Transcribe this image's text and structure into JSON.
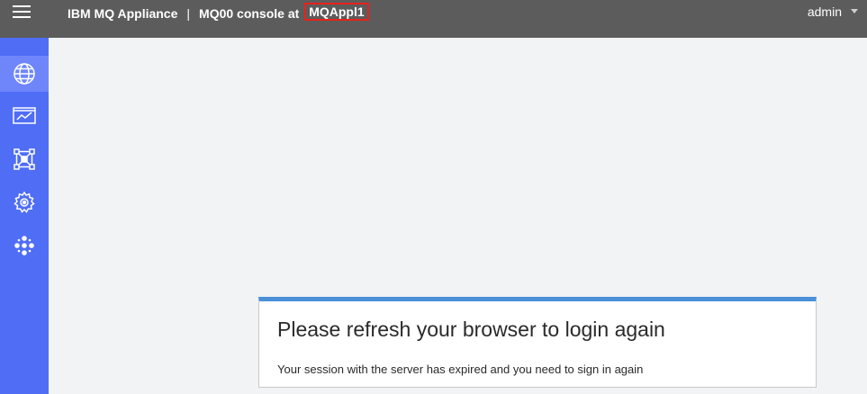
{
  "header": {
    "product": "IBM MQ Appliance",
    "separator": "|",
    "console_label": "MQ00 console at",
    "appliance_name": "MQAppl1",
    "user": "admin"
  },
  "sidebar": {
    "items": [
      {
        "icon": "globe-icon",
        "active": true
      },
      {
        "icon": "monitor-chart-icon",
        "active": false
      },
      {
        "icon": "network-nodes-icon",
        "active": false
      },
      {
        "icon": "gear-icon",
        "active": false
      },
      {
        "icon": "dots-cluster-icon",
        "active": false
      }
    ]
  },
  "dialog": {
    "title": "Please refresh your browser to login again",
    "message": "Your session with the server has expired and you need to sign in again"
  },
  "colors": {
    "topbar": "#5c5c5c",
    "sidebar": "#4f6df5",
    "sidebar_active": "#6f86fb",
    "dialog_accent": "#4a90d9",
    "highlight_box": "#e8221b",
    "background": "#f2f3f5"
  }
}
